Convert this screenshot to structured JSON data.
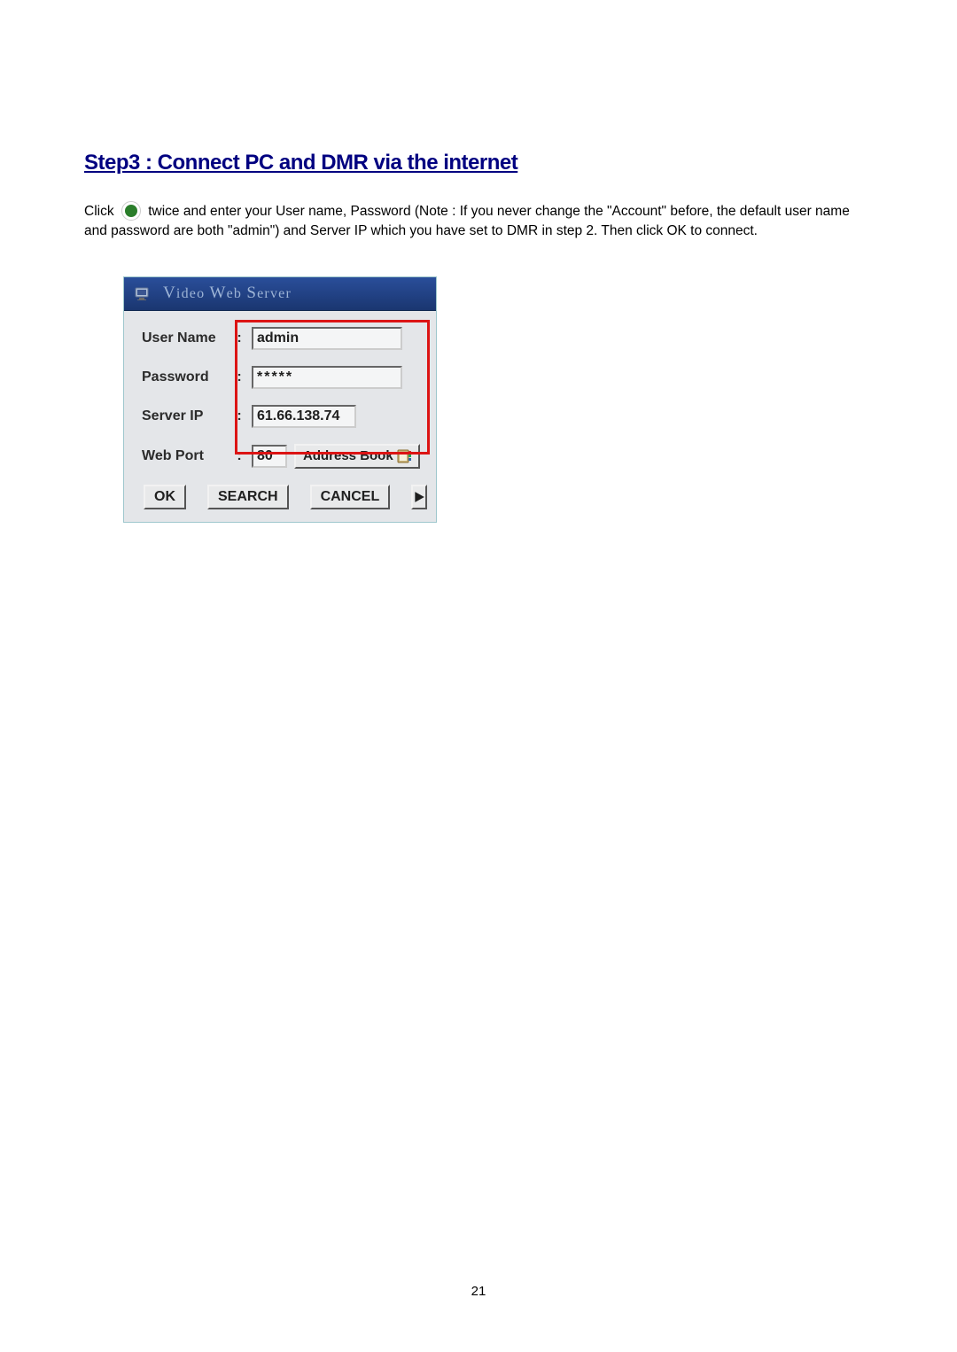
{
  "heading": "Step3 : Connect PC and DMR via the internet",
  "instruction": {
    "part1": "Click",
    "part2": "twice and enter your User name, Password (Note : If you never change the \"Account\" before, the default user name and password are both \"admin\") and Server IP which you have set to DMR in step 2. Then click OK to connect."
  },
  "dialog": {
    "title_caps": [
      "V",
      "W",
      "S"
    ],
    "title_lower": [
      "ideo",
      "eb",
      "erver"
    ],
    "labels": {
      "username": "User Name",
      "password": "Password",
      "serverip": "Server IP",
      "webport": "Web Port"
    },
    "values": {
      "username": "admin",
      "password": "*****",
      "serverip": "61.66.138.74",
      "webport": "80"
    },
    "buttons": {
      "addressbook": "Address Book",
      "ok": "OK",
      "search": "SEARCH",
      "cancel": "CANCEL"
    }
  },
  "page_number": "21"
}
